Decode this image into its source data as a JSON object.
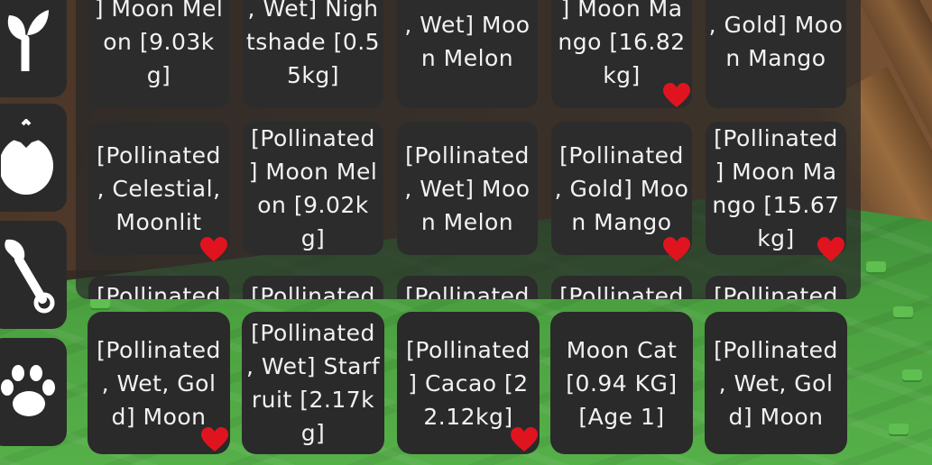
{
  "colors": {
    "slot_bg": "#2c2c2c",
    "text": "#f2f2f2",
    "heart": "#e0141e",
    "grass": "#4aa03f"
  },
  "sidebar": {
    "items": [
      {
        "icon": "sprout-icon"
      },
      {
        "icon": "tomato-icon"
      },
      {
        "icon": "trowel-icon"
      },
      {
        "icon": "paw-icon"
      }
    ]
  },
  "inventory": {
    "row1": [
      {
        "label": "] Moon Melon [9.03kg]",
        "favorite": false
      },
      {
        "label": ", Wet] Nightshade [0.55kg]",
        "favorite": false
      },
      {
        "label": ", Wet] Moon Melon",
        "favorite": false
      },
      {
        "label": "] Moon Mango [16.82kg]",
        "favorite": true
      },
      {
        "label": ", Gold] Moon Mango",
        "favorite": false
      }
    ],
    "row2": [
      {
        "label": "[Pollinated , Celestial, Moonlit",
        "favorite": true
      },
      {
        "label": "[Pollinated ] Moon Melon [9.02kg]",
        "favorite": false
      },
      {
        "label": "[Pollinated , Wet] Moon Melon",
        "favorite": false
      },
      {
        "label": "[Pollinated , Gold] Moon Mango",
        "favorite": true
      },
      {
        "label": "[Pollinated ] Moon Mango [15.67kg]",
        "favorite": true
      }
    ],
    "row3": [
      {
        "label": "[Pollinated"
      },
      {
        "label": "[Pollinated"
      },
      {
        "label": "[Pollinated"
      },
      {
        "label": "[Pollinated"
      },
      {
        "label": "[Pollinated"
      }
    ]
  },
  "hotbar": [
    {
      "label": "[Pollinated , Wet, Gold] Moon",
      "favorite": true
    },
    {
      "label": "[Pollinated , Wet] Starfruit [2.17kg]",
      "favorite": false
    },
    {
      "label": "[Pollinated ] Cacao [22.12kg]",
      "favorite": true
    },
    {
      "label": "Moon Cat [0.94 KG] [Age 1]",
      "favorite": false
    },
    {
      "label": "[Pollinated , Wet, Gold] Moon",
      "favorite": false
    }
  ]
}
